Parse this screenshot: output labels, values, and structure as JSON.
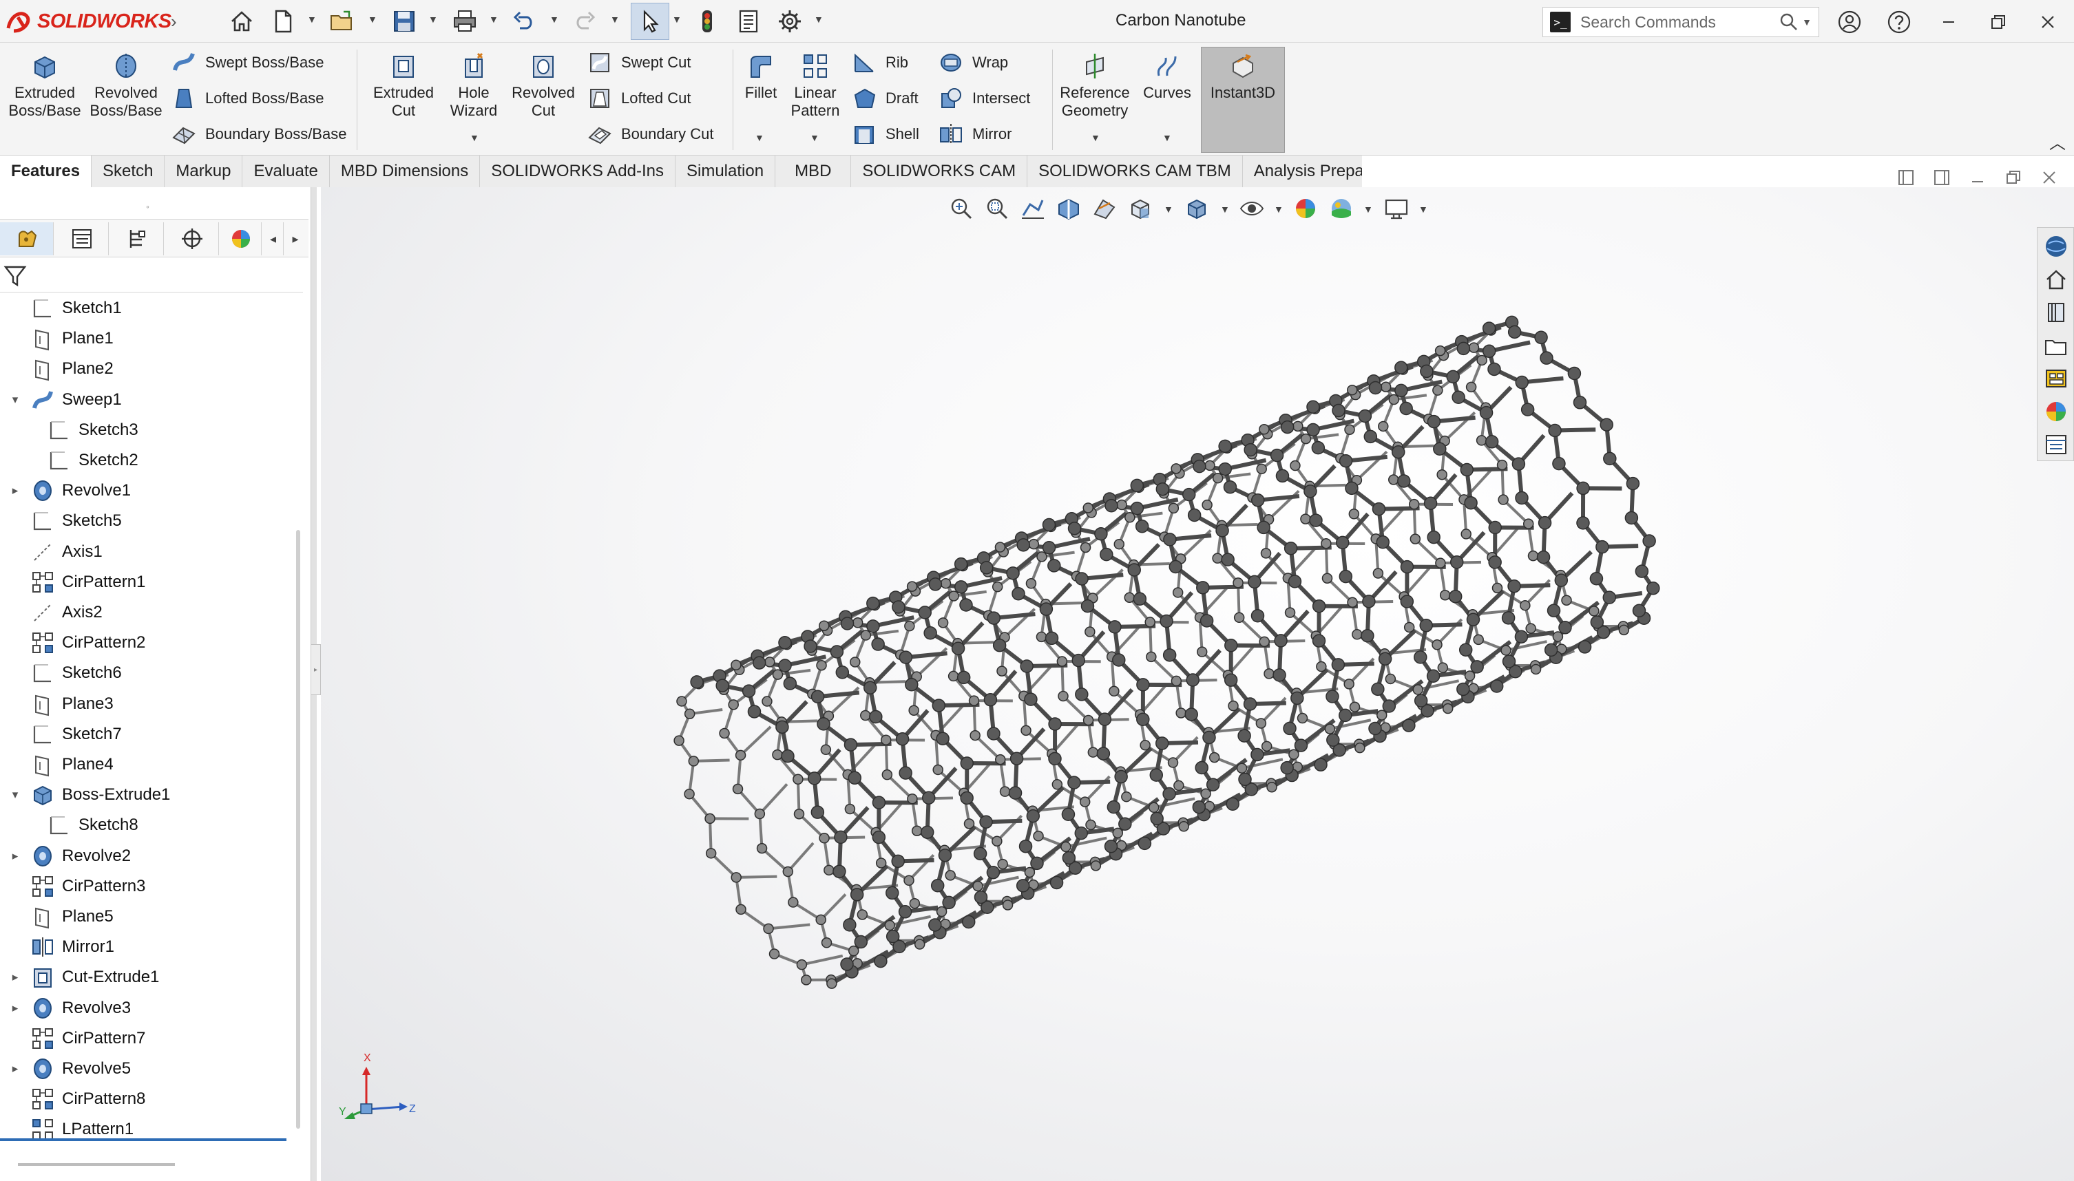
{
  "app": {
    "logo_text": "SOLIDWORKS",
    "document_title": "Carbon Nanotube",
    "search_placeholder": "Search Commands"
  },
  "quick_access": [
    {
      "name": "home",
      "icon": "home-icon"
    },
    {
      "name": "new",
      "icon": "new-document-icon"
    },
    {
      "name": "open",
      "icon": "open-folder-icon"
    },
    {
      "name": "save",
      "icon": "save-icon"
    },
    {
      "name": "print",
      "icon": "print-icon"
    },
    {
      "name": "undo",
      "icon": "undo-icon"
    },
    {
      "name": "redo",
      "icon": "redo-icon"
    },
    {
      "name": "select",
      "icon": "cursor-icon"
    },
    {
      "name": "rebuild",
      "icon": "traffic-light-icon"
    },
    {
      "name": "file-properties",
      "icon": "file-properties-icon"
    },
    {
      "name": "options",
      "icon": "gear-icon"
    }
  ],
  "features": {
    "extruded_boss": "Extruded Boss/Base",
    "revolved_boss": "Revolved Boss/Base",
    "swept_boss": "Swept Boss/Base",
    "lofted_boss": "Lofted Boss/Base",
    "boundary_boss": "Boundary Boss/Base",
    "extruded_cut": "Extruded Cut",
    "hole_wizard": "Hole Wizard",
    "revolved_cut": "Revolved Cut",
    "swept_cut": "Swept Cut",
    "lofted_cut": "Lofted Cut",
    "boundary_cut": "Boundary Cut",
    "fillet": "Fillet",
    "linear_pattern": "Linear Pattern",
    "rib": "Rib",
    "draft": "Draft",
    "shell": "Shell",
    "wrap": "Wrap",
    "intersect": "Intersect",
    "mirror": "Mirror",
    "reference_geometry": "Reference Geometry",
    "curves": "Curves",
    "instant3d": "Instant3D"
  },
  "tabs": [
    "Features",
    "Sketch",
    "Markup",
    "Evaluate",
    "MBD Dimensions",
    "SOLIDWORKS Add-Ins",
    "Simulation",
    "MBD",
    "SOLIDWORKS CAM",
    "SOLIDWORKS CAM TBM",
    "Analysis Preparation"
  ],
  "active_tab": "Features",
  "feature_tree": [
    {
      "label": "Sketch1",
      "icon": "sketch-icon",
      "depth": 0,
      "expander": ""
    },
    {
      "label": "Plane1",
      "icon": "plane-icon",
      "depth": 0,
      "expander": ""
    },
    {
      "label": "Plane2",
      "icon": "plane-icon",
      "depth": 0,
      "expander": ""
    },
    {
      "label": "Sweep1",
      "icon": "sweep-icon",
      "depth": 0,
      "expander": "expanded"
    },
    {
      "label": "Sketch3",
      "icon": "sketch-icon",
      "depth": 1,
      "expander": ""
    },
    {
      "label": "Sketch2",
      "icon": "sketch-icon",
      "depth": 1,
      "expander": ""
    },
    {
      "label": "Revolve1",
      "icon": "revolve-icon",
      "depth": 0,
      "expander": "collapsed"
    },
    {
      "label": "Sketch5",
      "icon": "sketch-icon",
      "depth": 0,
      "expander": ""
    },
    {
      "label": "Axis1",
      "icon": "axis-icon",
      "depth": 0,
      "expander": ""
    },
    {
      "label": "CirPattern1",
      "icon": "circular-pattern-icon",
      "depth": 0,
      "expander": ""
    },
    {
      "label": "Axis2",
      "icon": "axis-icon",
      "depth": 0,
      "expander": ""
    },
    {
      "label": "CirPattern2",
      "icon": "circular-pattern-icon",
      "depth": 0,
      "expander": ""
    },
    {
      "label": "Sketch6",
      "icon": "sketch-icon",
      "depth": 0,
      "expander": ""
    },
    {
      "label": "Plane3",
      "icon": "plane-icon",
      "depth": 0,
      "expander": ""
    },
    {
      "label": "Sketch7",
      "icon": "sketch-icon",
      "depth": 0,
      "expander": ""
    },
    {
      "label": "Plane4",
      "icon": "plane-icon",
      "depth": 0,
      "expander": ""
    },
    {
      "label": "Boss-Extrude1",
      "icon": "extrude-icon",
      "depth": 0,
      "expander": "expanded"
    },
    {
      "label": "Sketch8",
      "icon": "sketch-icon",
      "depth": 1,
      "expander": ""
    },
    {
      "label": "Revolve2",
      "icon": "revolve-icon",
      "depth": 0,
      "expander": "collapsed"
    },
    {
      "label": "CirPattern3",
      "icon": "circular-pattern-icon",
      "depth": 0,
      "expander": ""
    },
    {
      "label": "Plane5",
      "icon": "plane-icon",
      "depth": 0,
      "expander": ""
    },
    {
      "label": "Mirror1",
      "icon": "mirror-icon",
      "depth": 0,
      "expander": ""
    },
    {
      "label": "Cut-Extrude1",
      "icon": "cut-extrude-icon",
      "depth": 0,
      "expander": "collapsed"
    },
    {
      "label": "Revolve3",
      "icon": "revolve-icon",
      "depth": 0,
      "expander": "collapsed"
    },
    {
      "label": "CirPattern7",
      "icon": "circular-pattern-icon",
      "depth": 0,
      "expander": ""
    },
    {
      "label": "Revolve5",
      "icon": "revolve-icon",
      "depth": 0,
      "expander": "collapsed"
    },
    {
      "label": "CirPattern8",
      "icon": "circular-pattern-icon",
      "depth": 0,
      "expander": ""
    },
    {
      "label": "LPattern1",
      "icon": "linear-pattern-icon",
      "depth": 0,
      "expander": ""
    }
  ],
  "triad": {
    "x": "X",
    "y": "Y",
    "z": "Z"
  },
  "colors": {
    "brand": "#d9241b",
    "accent": "#2d6cb5",
    "model": "#4a4a4a"
  }
}
